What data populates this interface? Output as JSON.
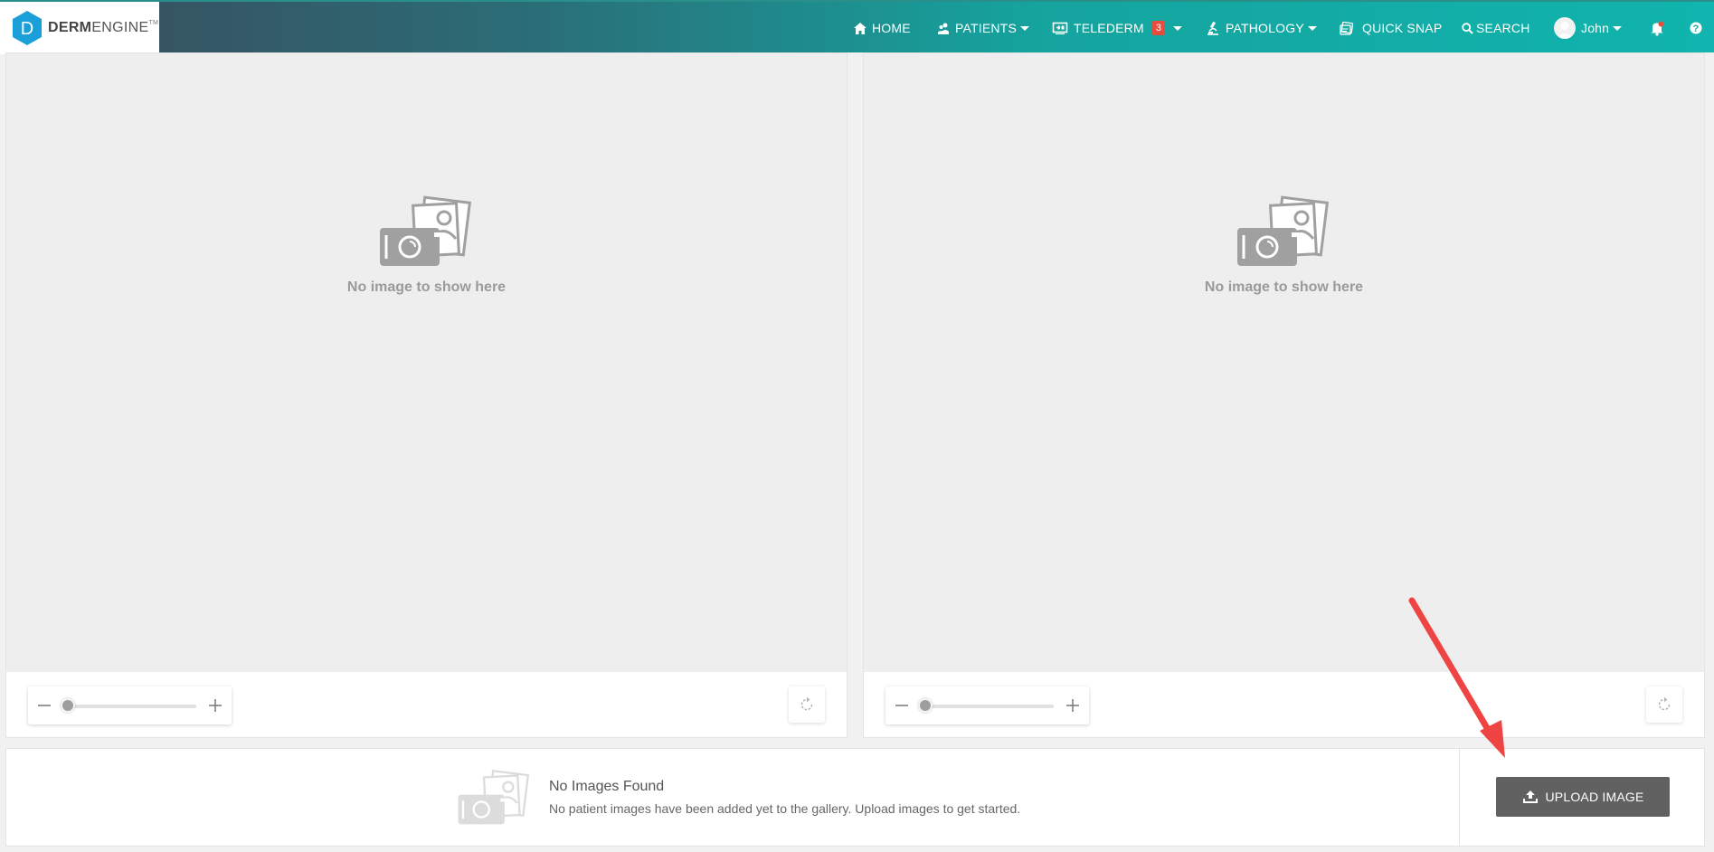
{
  "brand": {
    "letter": "D",
    "name_bold": "DERM",
    "name_light": "ENGINE",
    "trademark": "TM"
  },
  "nav": {
    "home": "HOME",
    "patients": "PATIENTS",
    "telederm": "TELEDERM",
    "telederm_badge": "3",
    "pathology": "PATHOLOGY",
    "quick_snap": "QUICK SNAP",
    "search": "SEARCH",
    "user": "John"
  },
  "viewers": {
    "left": {
      "message": "No image to show here",
      "zoom_level": 0
    },
    "right": {
      "message": "No image to show here",
      "zoom_level": 0
    }
  },
  "gallery": {
    "title": "No Images Found",
    "description": "No patient images have been added yet to the gallery. Upload images to get started.",
    "upload_label": "UPLOAD IMAGE"
  },
  "colors": {
    "accent": "#11b4ae",
    "badge": "#e74c3c",
    "annotation_arrow": "#ef4444",
    "upload_button": "#616161"
  },
  "icons": {
    "home": "home-icon",
    "patients": "patients-icon",
    "telederm": "telederm-icon",
    "pathology": "microscope-icon",
    "quick_snap": "quick-snap-icon",
    "search": "search-icon",
    "notifications": "bell-icon",
    "help": "help-icon",
    "upload": "upload-icon",
    "rotate": "rotate-icon"
  }
}
